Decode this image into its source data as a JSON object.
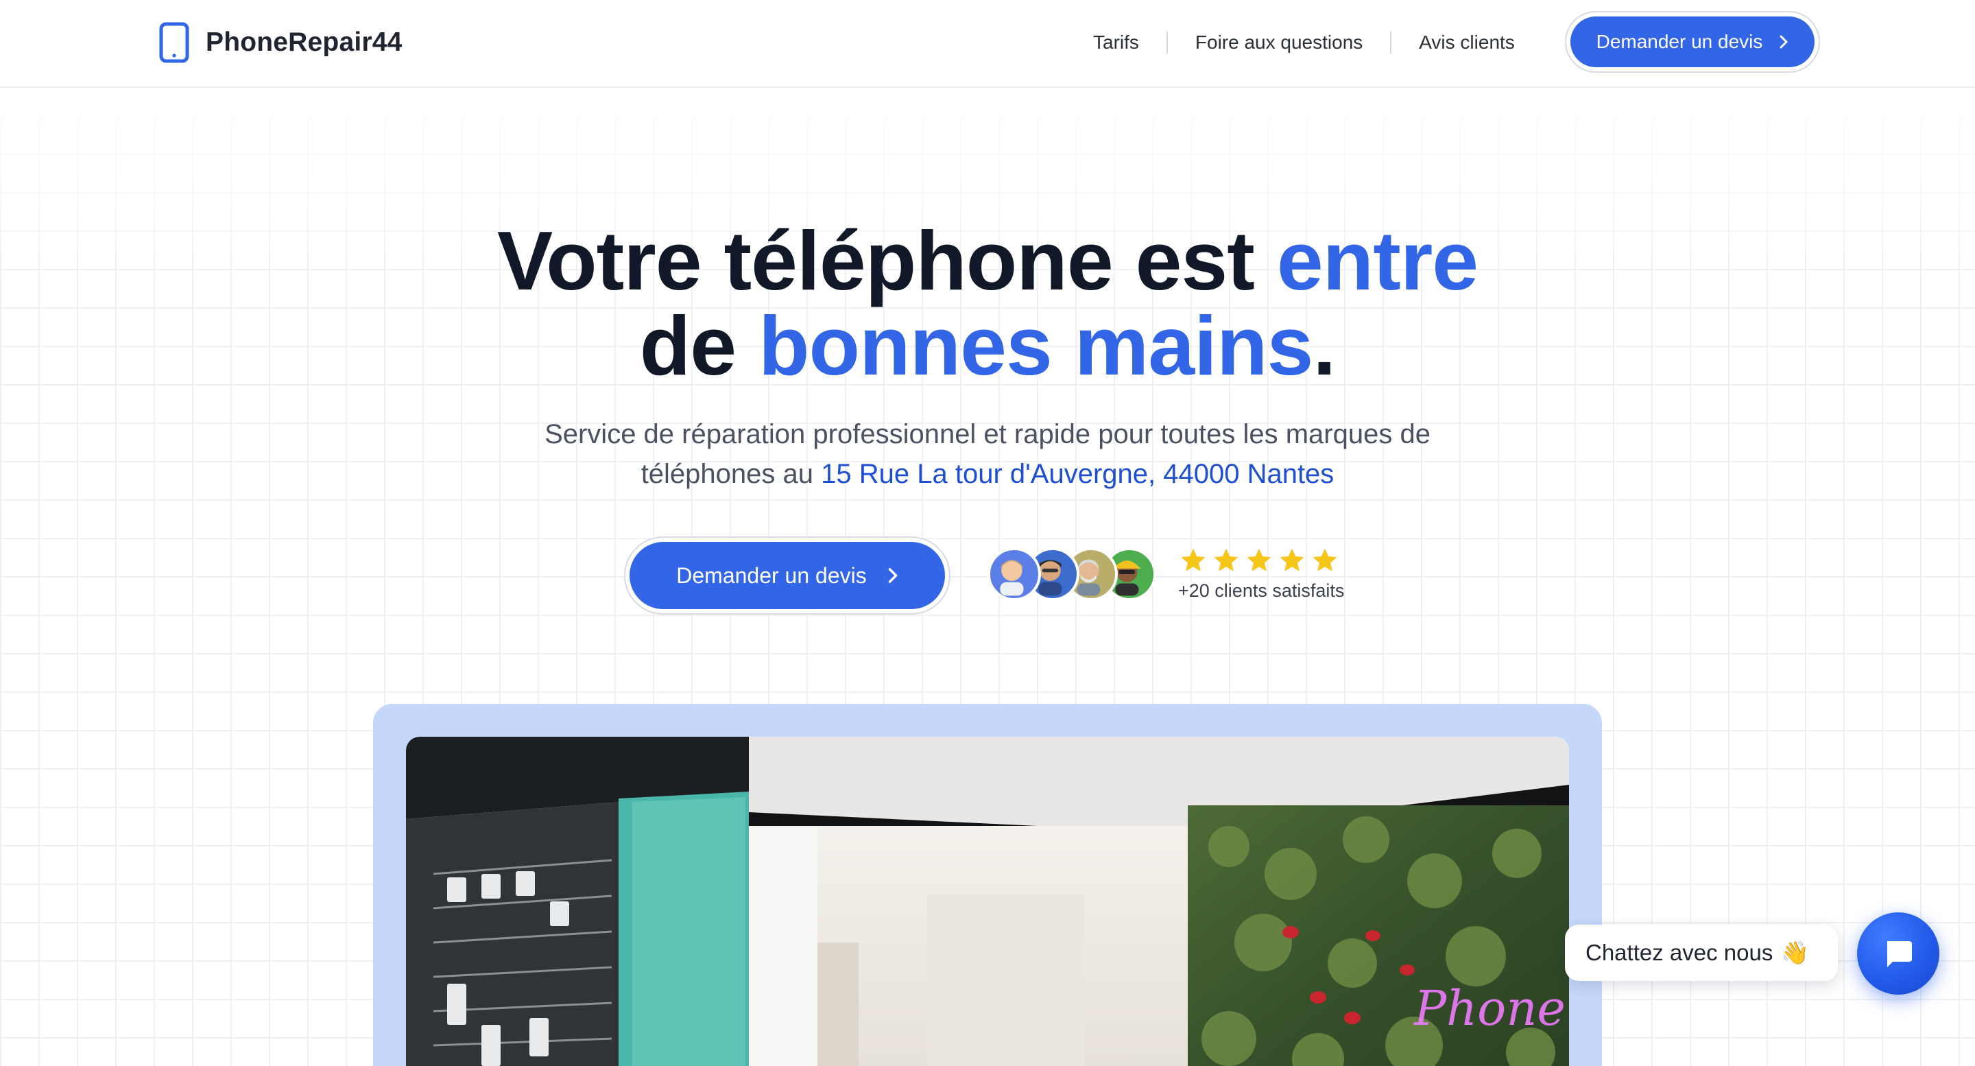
{
  "brand": {
    "name": "PhoneRepair44",
    "icon": "phone-icon",
    "accent_color": "#3366e6"
  },
  "nav": {
    "items": [
      "Tarifs",
      "Foire aux questions",
      "Avis clients"
    ],
    "cta_label": "Demander un devis"
  },
  "hero": {
    "title_line1_dark": "Votre téléphone est",
    "title_line1_accent": "entre",
    "title_line2_dark": "de",
    "title_line2_accent": "bonnes mains",
    "title_end": ".",
    "subtitle_line1": "Service de réparation professionnel et rapide pour toutes les marques de",
    "subtitle_line2_prefix": "téléphones au",
    "address": "15 Rue La tour d'Auvergne, 44000 Nantes",
    "cta_label": "Demander un devis"
  },
  "social_proof": {
    "rating_stars": 5,
    "rating_max": 5,
    "avatar_colors": [
      "#5b7fe6",
      "#3d6ccf",
      "#b9ad6a",
      "#4cae4f"
    ],
    "satisfied_label": "+20 clients satisfaits",
    "star_color": "#f5c518"
  },
  "chat": {
    "bubble_text": "Chattez avec nous",
    "bubble_emoji": "👋",
    "button_icon": "chat-icon"
  }
}
